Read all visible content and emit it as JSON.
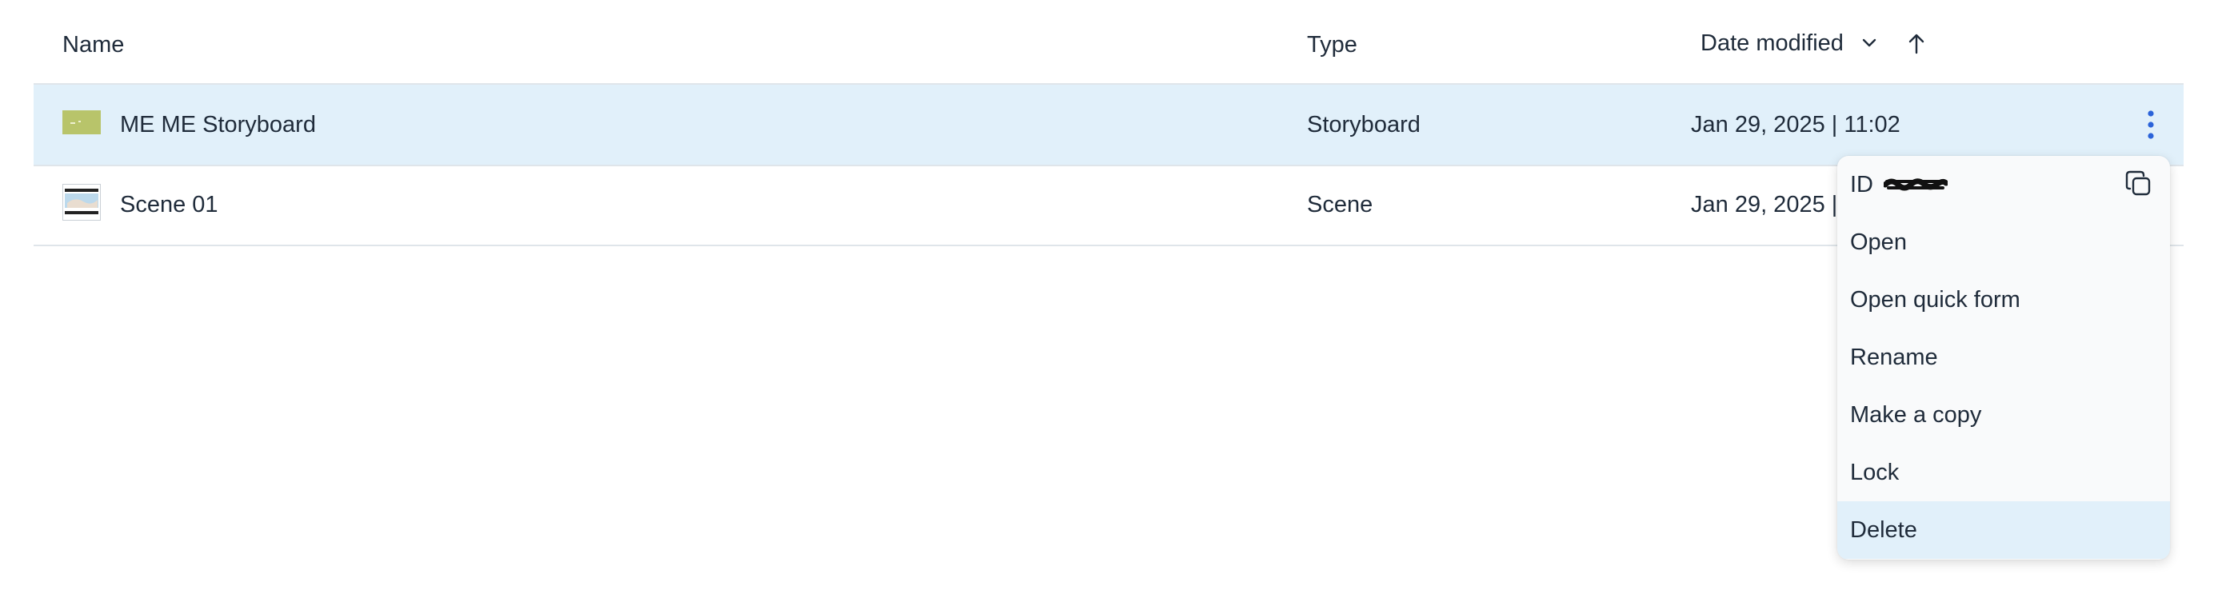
{
  "table": {
    "columns": {
      "name": "Name",
      "type": "Type",
      "date": "Date modified"
    },
    "rows": [
      {
        "name": "ME ME Storyboard",
        "type": "Storyboard",
        "date": "Jan 29, 2025 | 11:02"
      },
      {
        "name": "Scene 01",
        "type": "Scene",
        "date": "Jan 29, 2025 | 1"
      }
    ]
  },
  "context_menu": {
    "id_label": "ID",
    "items": [
      "Open",
      "Open quick form",
      "Rename",
      "Make a copy",
      "Lock",
      "Delete"
    ]
  },
  "colors": {
    "selected_row": "#e1f0fa",
    "accent": "#2b63d9",
    "thumb_storyboard": "#b8c46a"
  }
}
